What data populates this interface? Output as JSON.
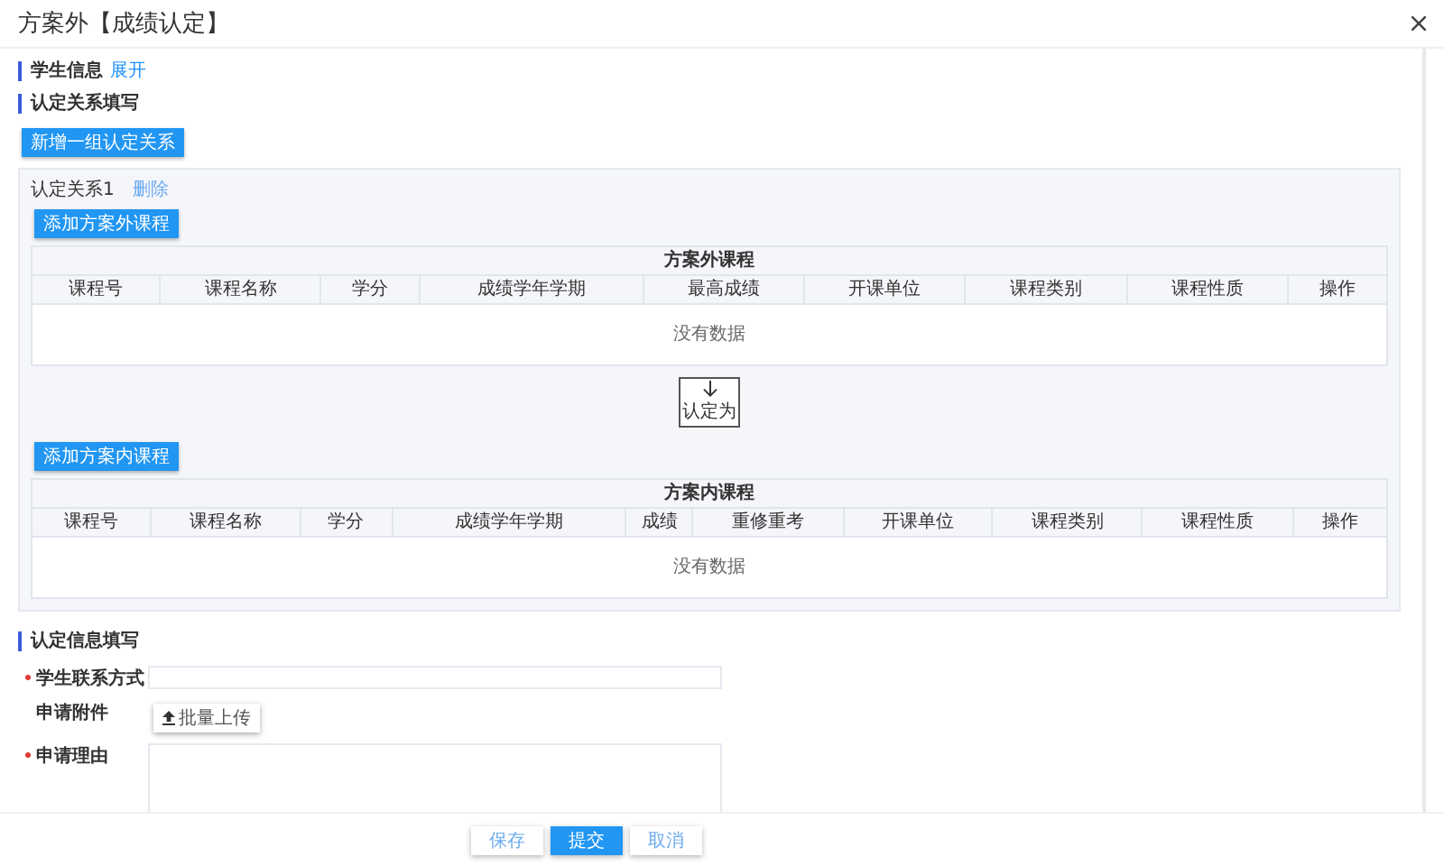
{
  "window": {
    "title": "方案外【成绩认定】"
  },
  "student_info": {
    "title": "学生信息",
    "toggle": "展开"
  },
  "relation_section": {
    "title": "认定关系填写",
    "add_button": "新增一组认定关系"
  },
  "relations": [
    {
      "label": "认定关系1",
      "delete_link": "删除",
      "add_outside_button": "添加方案外课程",
      "outside_table": {
        "title": "方案外课程",
        "columns": [
          "课程号",
          "课程名称",
          "学分",
          "成绩学年学期",
          "最高成绩",
          "开课单位",
          "课程类别",
          "课程性质",
          "操作"
        ],
        "empty_text": "没有数据"
      },
      "convert_button": "认定为",
      "add_inside_button": "添加方案内课程",
      "inside_table": {
        "title": "方案内课程",
        "columns": [
          "课程号",
          "课程名称",
          "学分",
          "成绩学年学期",
          "成绩",
          "重修重考",
          "开课单位",
          "课程类别",
          "课程性质",
          "操作"
        ],
        "empty_text": "没有数据"
      }
    }
  ],
  "info_section": {
    "title": "认定信息填写",
    "fields": [
      {
        "kind": "text",
        "label": "学生联系方式",
        "required": true
      },
      {
        "kind": "upload",
        "label": "申请附件",
        "required": false,
        "button": "批量上传"
      },
      {
        "kind": "textarea",
        "label": "申请理由",
        "required": true
      }
    ]
  },
  "footer_buttons": [
    {
      "label": "保存",
      "kind": "default"
    },
    {
      "label": "提交",
      "kind": "primary"
    },
    {
      "label": "取消",
      "kind": "default"
    }
  ]
}
